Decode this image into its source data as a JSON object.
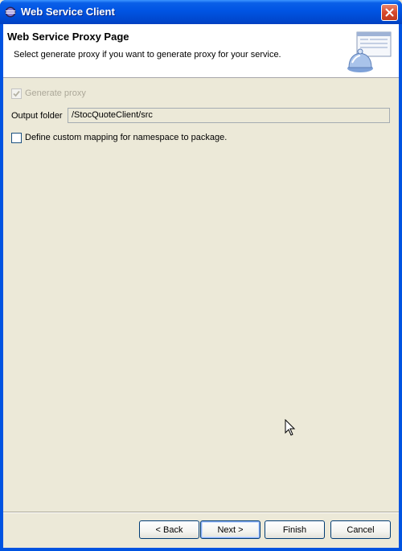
{
  "window": {
    "title": "Web Service Client",
    "icons": {
      "app": "eclipse-icon",
      "close": "close-icon"
    }
  },
  "header": {
    "title": "Web Service Proxy Page",
    "description": "Select generate proxy if you want to generate proxy for your service.",
    "banner_icon": "wizard-banner-icon"
  },
  "form": {
    "generate_proxy": {
      "label": "Generate proxy",
      "checked": true,
      "enabled": false
    },
    "output_folder": {
      "label": "Output folder",
      "value": "/StocQuoteClient/src"
    },
    "custom_mapping": {
      "label": "Define custom mapping for namespace to package.",
      "checked": false
    }
  },
  "buttons": {
    "back": "< Back",
    "next": "Next >",
    "finish": "Finish",
    "cancel": "Cancel"
  },
  "colors": {
    "titlebar": "#0054e3",
    "dialog_bg": "#ece9d8",
    "close_button": "#d8492b"
  }
}
